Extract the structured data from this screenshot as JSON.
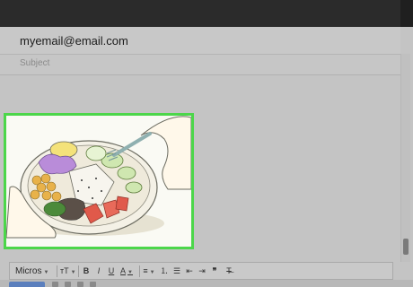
{
  "compose": {
    "to": "myemail@email.com",
    "subject_placeholder": "Subject"
  },
  "toolbar": {
    "font": "Micros",
    "size_icon": "text-size-icon",
    "bold": "B",
    "italic": "I",
    "underline": "U",
    "text_color": "A",
    "align_icon": "align-left-icon",
    "numbered_list_icon": "numbered-list-icon",
    "bulleted_list_icon": "bulleted-list-icon",
    "indent_less_icon": "indent-less-icon",
    "indent_more_icon": "indent-more-icon",
    "quote": "❞",
    "clear_format_icon": "clear-formatting-icon"
  },
  "image": {
    "icon": "food-bowl-illustration",
    "highlight_color": "#4cd64a"
  },
  "colors": {
    "topbar": "#2b2b2b",
    "background": "#c4c4c4",
    "send_button": "#5b7fbd"
  }
}
